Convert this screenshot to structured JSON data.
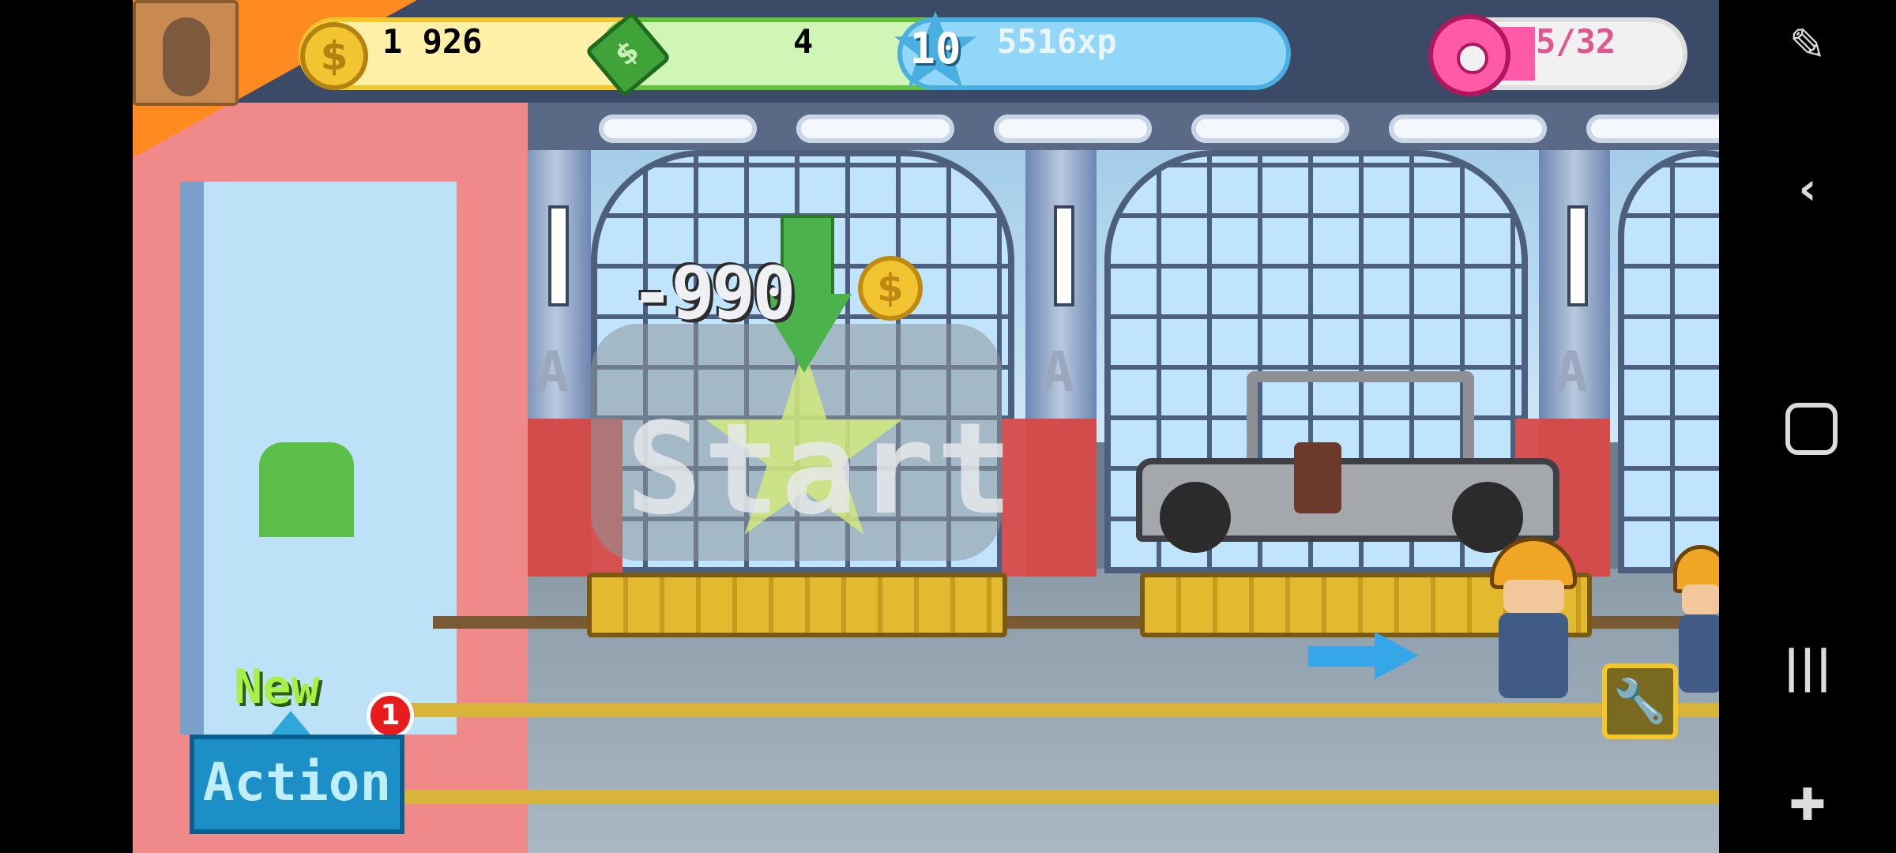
{
  "hud": {
    "coins": "1 926",
    "coins_plus": "+",
    "cash": "4",
    "cash_plus": "+",
    "level": "10",
    "xp": "5516xp",
    "donuts": "5/32"
  },
  "scene": {
    "cost": "-990",
    "start_label": "Start",
    "pillar_letter": "A"
  },
  "action": {
    "new_label": "New",
    "badge_count": "1",
    "button_label": "Action"
  },
  "icons": {
    "coin": "$",
    "cash": "$",
    "wrench": "🔧"
  },
  "colors": {
    "coin_gold": "#f2c431",
    "cash_green": "#66c23a",
    "xp_blue": "#49aee0",
    "donut_pink": "#ff5aa8",
    "action_blue": "#1c8fc6"
  }
}
